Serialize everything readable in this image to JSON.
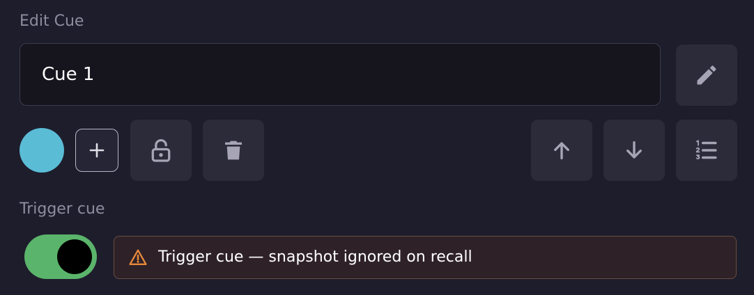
{
  "edit_section": {
    "label": "Edit Cue",
    "name_value": "Cue 1"
  },
  "icons": {
    "rename": "pencil-icon",
    "add": "plus-icon",
    "lock": "unlock-icon",
    "delete": "trash-icon",
    "move_up": "arrow-up-icon",
    "move_down": "arrow-down-icon",
    "list": "numbered-list-icon",
    "warning": "warning-triangle-icon"
  },
  "cue_color": "#5bbcd6",
  "trigger_section": {
    "label": "Trigger cue",
    "toggle_on": true,
    "warning_text": "Trigger cue — snapshot ignored on recall"
  },
  "colors": {
    "background": "#1e1d2c",
    "button": "#2c2b3a",
    "toggle_on": "#5bb46b",
    "warning_bg": "#2e2228",
    "warning_border": "#6a4d3e",
    "warning_icon": "#e8883a"
  }
}
